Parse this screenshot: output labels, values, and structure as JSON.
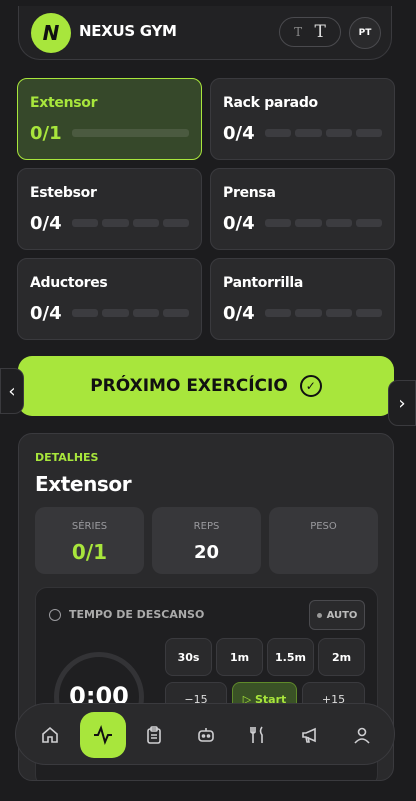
{
  "header": {
    "logo_letter": "N",
    "brand": "NEXUS GYM",
    "font_small": "T",
    "font_large": "T",
    "lang": "PT"
  },
  "exercises": [
    {
      "name": "Extensor",
      "count": "0/1",
      "active": true
    },
    {
      "name": "Rack parado",
      "count": "0/4"
    },
    {
      "name": "Estebsor",
      "count": "0/4"
    },
    {
      "name": "Prensa",
      "count": "0/4"
    },
    {
      "name": "Aductores",
      "count": "0/4"
    },
    {
      "name": "Pantorrilla",
      "count": "0/4"
    }
  ],
  "next_button": {
    "label": "PRÓXIMO EXERCÍCIO"
  },
  "details": {
    "label": "DETALHES",
    "title": "Extensor",
    "stats": [
      {
        "key": "SÉRIES",
        "value": "0/1"
      },
      {
        "key": "REPS",
        "value": "20"
      },
      {
        "key": "PESO",
        "value": ""
      }
    ]
  },
  "rest": {
    "title": "TEMPO DE DESCANSO",
    "auto_label": "AUTO",
    "presets": [
      "30s",
      "1m",
      "1.5m",
      "2m"
    ],
    "time": "0:00",
    "minus": "−15",
    "start": "▷ Start",
    "plus": "+15"
  },
  "nav": {
    "items": [
      "home",
      "activity",
      "clipboard",
      "robot",
      "utensils",
      "megaphone",
      "user"
    ],
    "active_index": 1
  },
  "colors": {
    "accent": "#a8e63c",
    "bg": "#1c1c1e",
    "card": "#2a2a2c"
  }
}
